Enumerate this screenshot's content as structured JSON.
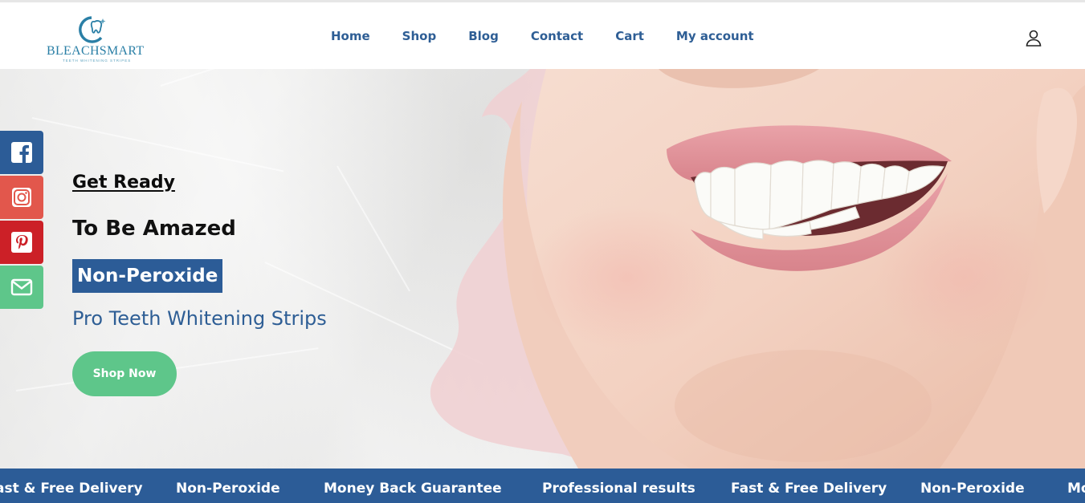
{
  "header": {
    "logo": {
      "name": "BLEACHSMART",
      "tagline": "TEETH WHITENING STRIPES"
    },
    "nav": [
      "Home",
      "Shop",
      "Blog",
      "Contact",
      "Cart",
      "My account"
    ],
    "user_icon": "user-icon"
  },
  "hero": {
    "kicker": "Get Ready",
    "title": "To Be Amazed",
    "highlight": "Non-Peroxide",
    "subtitle": "Pro Teeth Whitening Strips",
    "cta": "Shop Now"
  },
  "social": [
    "facebook-icon",
    "instagram-icon",
    "pinterest-icon",
    "mail-icon"
  ],
  "ticker": [
    "ast & Free Delivery",
    "Non-Peroxide",
    "Money Back Guarantee",
    "Professional results",
    "Fast & Free Delivery",
    "Non-Peroxide",
    "Mo"
  ],
  "colors": {
    "brand_blue": "#2c5c97",
    "accent_green": "#5ec68a",
    "logo_blue": "#2a7fa6"
  }
}
